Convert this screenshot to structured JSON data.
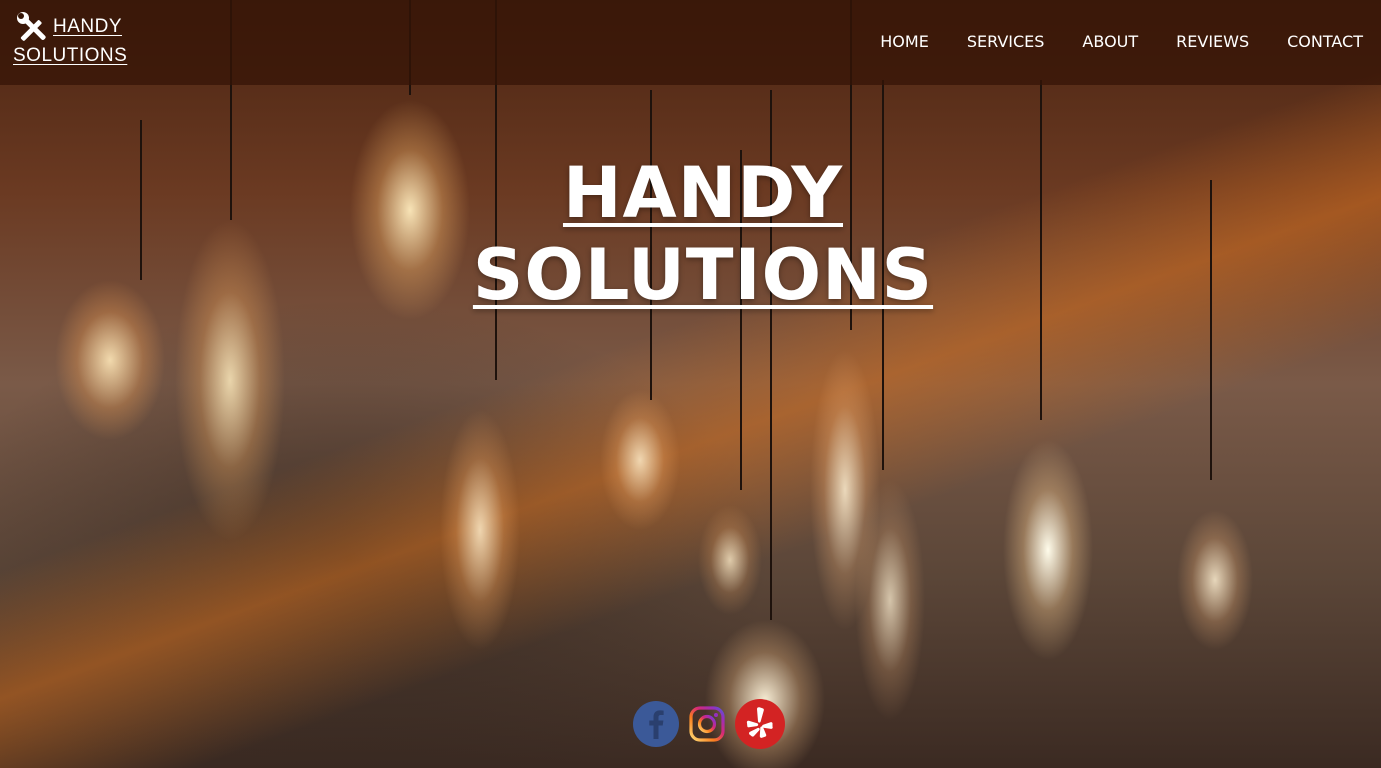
{
  "brand": {
    "line1": "HANDY",
    "line2": "SOLUTIONS",
    "icon": "wrench-screwdriver-icon"
  },
  "nav": {
    "items": [
      {
        "label": "HOME"
      },
      {
        "label": "SERVICES"
      },
      {
        "label": "ABOUT"
      },
      {
        "label": "REVIEWS"
      },
      {
        "label": "CONTACT"
      }
    ]
  },
  "hero": {
    "title_line1": "HANDY",
    "title_line2": "SOLUTIONS",
    "background": "hanging-edison-bulbs-photo"
  },
  "social": {
    "icons": [
      "facebook-icon",
      "instagram-icon",
      "yelp-icon"
    ]
  },
  "colors": {
    "topbar": "#341405",
    "facebook": "#3b5998",
    "yelp": "#d32323",
    "text": "#ffffff"
  }
}
